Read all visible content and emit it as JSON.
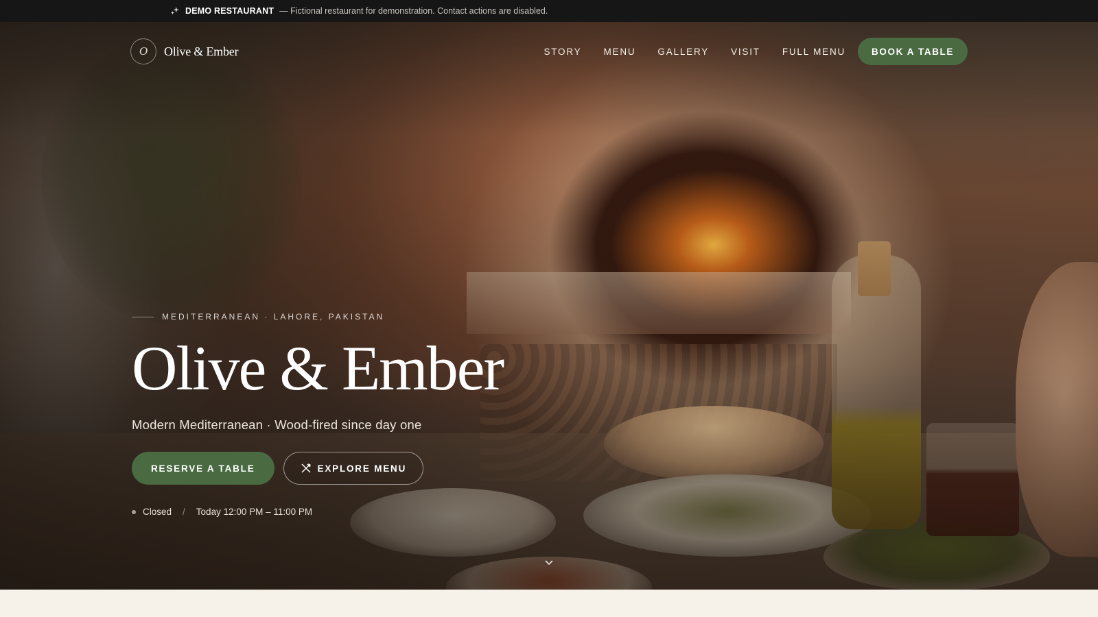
{
  "banner": {
    "icon": "sparkle-icon",
    "badge": "DEMO RESTAURANT",
    "note": "— Fictional restaurant for demonstration. Contact actions are disabled."
  },
  "nav": {
    "logo_mark": "O",
    "logo_text": "Olive & Ember",
    "links": [
      "STORY",
      "MENU",
      "GALLERY",
      "VISIT",
      "FULL MENU"
    ],
    "cta": "BOOK A TABLE"
  },
  "hero": {
    "eyebrow": "MEDITERRANEAN · LAHORE, PAKISTAN",
    "title": "Olive & Ember",
    "tagline": "Modern Mediterranean · Wood-fired since day one",
    "primary_button": "RESERVE A TABLE",
    "secondary_button": "EXPLORE MENU",
    "secondary_icon": "utensils-icon",
    "status": "Closed",
    "hours": "Today 12:00 PM – 11:00 PM",
    "scroll_icon": "chevron-down-icon"
  },
  "colors": {
    "accent": "#4a6b42",
    "banner_bg": "#161616",
    "page_bg": "#f6f2ea"
  }
}
